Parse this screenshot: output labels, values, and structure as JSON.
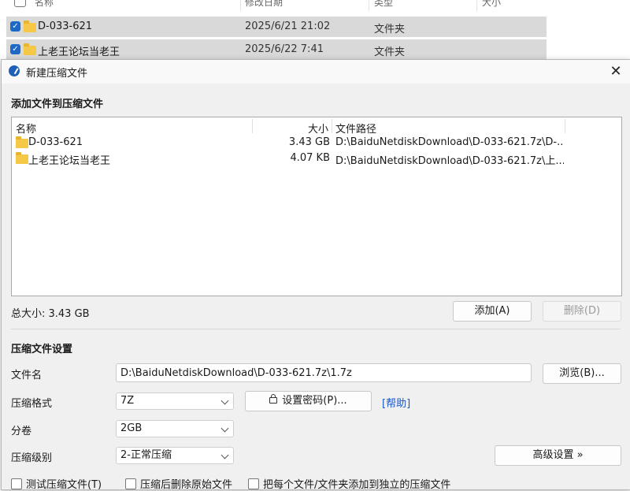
{
  "explorer": {
    "columns": {
      "name": "名称",
      "date": "修改日期",
      "type": "类型",
      "size": "大小"
    },
    "rows": [
      {
        "name": "D-033-621",
        "date": "2025/6/21 21:02",
        "type": "文件夹"
      },
      {
        "name": "上老王论坛当老王",
        "date": "2025/6/22 7:41",
        "type": "文件夹"
      }
    ]
  },
  "dialog": {
    "title": "新建压缩文件",
    "close_glyph": "✕",
    "add_section_title": "添加文件到压缩文件",
    "list": {
      "columns": {
        "name": "名称",
        "size": "大小",
        "path": "文件路径"
      },
      "rows": [
        {
          "name": "D-033-621",
          "size": "3.43 GB",
          "path": "D:\\BaiduNetdiskDownload\\D-033-621.7z\\D-..."
        },
        {
          "name": "上老王论坛当老王",
          "size": "4.07 KB",
          "path": "D:\\BaiduNetdiskDownload\\D-033-621.7z\\上..."
        }
      ]
    },
    "total_size": "总大小: 3.43 GB",
    "add_button": "添加(A)",
    "delete_button": "删除(D)",
    "settings_title": "压缩文件设置",
    "filename_label": "文件名",
    "filename_value": "D:\\BaiduNetdiskDownload\\D-033-621.7z\\1.7z",
    "browse_button": "浏览(B)...",
    "format_label": "压缩格式",
    "format_value": "7Z",
    "password_button": "设置密码(P)...",
    "help_link": "[帮助]",
    "split_label": "分卷",
    "split_value": "2GB",
    "level_label": "压缩级别",
    "level_value": "2-正常压缩",
    "advanced_button": "高级设置 »",
    "checkboxes": {
      "test": "测试压缩文件(T)",
      "delete_source": "压缩后删除原始文件",
      "separate": "把每个文件/文件夹添加到独立的压缩文件"
    }
  },
  "colors": {
    "selection": "#d9d9d9",
    "checkbox_accent": "#1d69c5",
    "folder": "#f6c848",
    "link": "#1a56c4"
  }
}
